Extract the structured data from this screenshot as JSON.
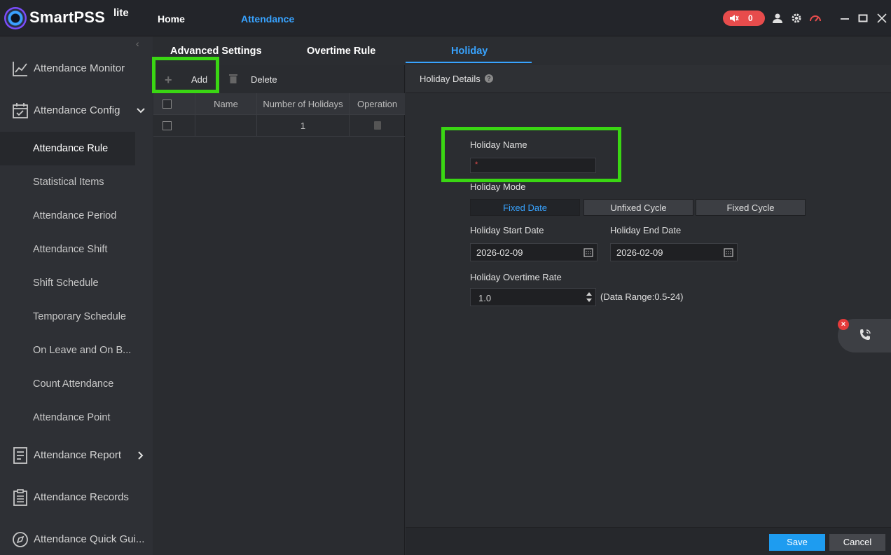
{
  "app": {
    "brand": "SmartPSS",
    "brand_suffix": "lite",
    "nav": {
      "home": "Home",
      "attendance": "Attendance"
    },
    "alarm_count": "0",
    "accent_color": "#38a3ff",
    "highlight_color": "#3ad613"
  },
  "sidebar": {
    "groups": [
      {
        "label": "Attendance Monitor",
        "icon": "chart-line-icon"
      },
      {
        "label": "Attendance Config",
        "icon": "calendar-check-icon",
        "expanded": true
      },
      {
        "label": "Attendance Report",
        "icon": "report-icon"
      },
      {
        "label": "Attendance Records",
        "icon": "clipboard-icon"
      },
      {
        "label": "Attendance Quick Gui...",
        "icon": "compass-icon"
      }
    ],
    "config_items": [
      {
        "label": "Attendance Rule",
        "active": true
      },
      {
        "label": "Statistical Items"
      },
      {
        "label": "Attendance Period"
      },
      {
        "label": "Attendance Shift"
      },
      {
        "label": "Shift Schedule"
      },
      {
        "label": "Temporary Schedule"
      },
      {
        "label": "On Leave and On B..."
      },
      {
        "label": "Count Attendance"
      },
      {
        "label": "Attendance Point"
      }
    ]
  },
  "subtabs": [
    {
      "label": "Advanced Settings"
    },
    {
      "label": "Overtime Rule"
    },
    {
      "label": "Holiday",
      "active": true
    }
  ],
  "list": {
    "add_label": "Add",
    "delete_label": "Delete",
    "columns": [
      "Name",
      "Number of Holidays",
      "Operation"
    ],
    "rows": [
      {
        "name": "",
        "count": "1"
      }
    ]
  },
  "detail": {
    "title": "Holiday Details",
    "holiday_name_label": "Holiday Name",
    "holiday_name_value": "",
    "required_mark": "*",
    "mode_label": "Holiday Mode",
    "modes": [
      {
        "label": "Fixed Date",
        "active": true
      },
      {
        "label": "Unfixed Cycle"
      },
      {
        "label": "Fixed Cycle"
      }
    ],
    "start_label": "Holiday Start Date",
    "start_value": "2026-02-09",
    "end_label": "Holiday End Date",
    "end_value": "2026-02-09",
    "rate_label": "Holiday Overtime Rate",
    "rate_value": "1.0",
    "rate_range": "(Data Range:0.5-24)"
  },
  "footer": {
    "save": "Save",
    "cancel": "Cancel"
  }
}
